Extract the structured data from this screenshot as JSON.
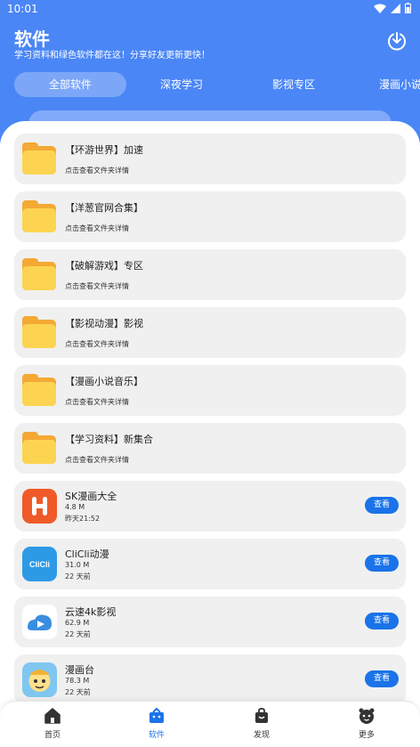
{
  "status": {
    "time": "10:01"
  },
  "header": {
    "title": "软件",
    "subtitle": "学习资料和绿色软件都在这！分享好友更新更快！"
  },
  "tabs": [
    {
      "label": "全部软件",
      "active": true
    },
    {
      "label": "深夜学习",
      "active": false
    },
    {
      "label": "影视专区",
      "active": false
    },
    {
      "label": "漫画小说",
      "active": false
    }
  ],
  "folders": [
    {
      "title": "【环游世界】加速",
      "sub": "点击查看文件夹详情"
    },
    {
      "title": "【洋葱官网合集】",
      "sub": "点击查看文件夹详情"
    },
    {
      "title": "【破解游戏】专区",
      "sub": "点击查看文件夹详情"
    },
    {
      "title": "【影视动漫】影视",
      "sub": "点击查看文件夹详情"
    },
    {
      "title": "【漫画小说音乐】",
      "sub": "点击查看文件夹详情"
    },
    {
      "title": "【学习资料】新集合",
      "sub": "点击查看文件夹详情"
    }
  ],
  "apps": [
    {
      "name": "SK漫画大全",
      "size": "4.8 M",
      "date": "昨天21:52",
      "icon": "sk-comic-icon",
      "button": "查看"
    },
    {
      "name": "CliCli动漫",
      "size": "31.0 M",
      "date": "22 天前",
      "icon": "clicli-icon",
      "button": "查看"
    },
    {
      "name": "云速4k影视",
      "size": "62.9 M",
      "date": "22 天前",
      "icon": "yunsu-icon",
      "button": "查看"
    },
    {
      "name": "漫画台",
      "size": "78.3 M",
      "date": "22 天前",
      "icon": "manhuatai-icon",
      "button": "查看"
    }
  ],
  "nav": [
    {
      "label": "首页",
      "icon": "home-icon",
      "active": false
    },
    {
      "label": "软件",
      "icon": "software-icon",
      "active": true
    },
    {
      "label": "发现",
      "icon": "discover-icon",
      "active": false
    },
    {
      "label": "更多",
      "icon": "more-icon",
      "active": false
    }
  ],
  "colors": {
    "primary": "#4a86f6",
    "accent": "#1a73e8",
    "folder": "#fdd451"
  }
}
